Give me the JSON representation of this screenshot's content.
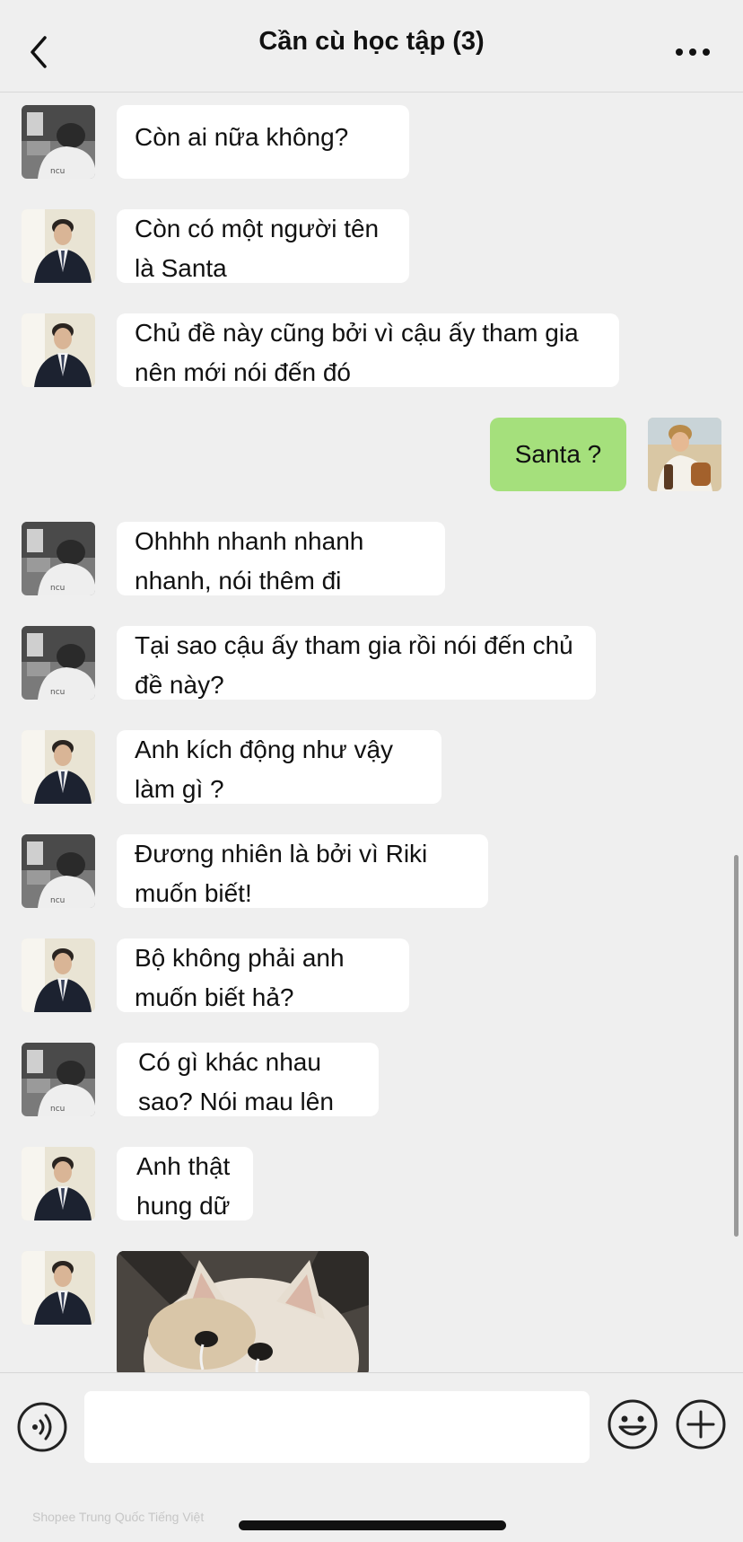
{
  "header": {
    "title": "Cần cù học tập (3)",
    "back_icon": "chevron-left-icon",
    "more_icon": "ellipsis-icon"
  },
  "messages": [
    {
      "sender": "friend-a",
      "text": "Còn ai nữa không?"
    },
    {
      "sender": "friend-b",
      "text": "Còn có một người tên là Santa"
    },
    {
      "sender": "friend-b",
      "text": "Chủ đề này cũng bởi vì cậu ấy tham gia nên mới nói đến đó"
    },
    {
      "sender": "me",
      "text": "Santa ?"
    },
    {
      "sender": "friend-a",
      "text": "Ohhhh nhanh nhanh nhanh, nói thêm đi"
    },
    {
      "sender": "friend-a",
      "text": "Tại sao cậu ấy tham gia rồi nói đến chủ đề này?"
    },
    {
      "sender": "friend-b",
      "text": "Anh kích động như vậy làm gì ?"
    },
    {
      "sender": "friend-a",
      "text": "Đương nhiên là bởi vì Riki muốn biết!"
    },
    {
      "sender": "friend-b",
      "text": "Bộ không phải anh muốn biết hả?"
    },
    {
      "sender": "friend-a",
      "text": "Có gì khác nhau sao? Nói mau lên"
    },
    {
      "sender": "friend-b",
      "text": "Anh thật hung dữ"
    },
    {
      "sender": "friend-b",
      "type": "sticker",
      "description": "crying-cat-sticker"
    }
  ],
  "input": {
    "placeholder": "",
    "voice_icon": "voice-icon",
    "emoji_icon": "emoji-icon",
    "plus_icon": "plus-icon"
  },
  "colors": {
    "background": "#efefef",
    "bubble_other": "#ffffff",
    "bubble_me": "#a5e07c",
    "text": "#111111"
  },
  "watermark": "Shopee Trung Quốc Tiếng Việt"
}
